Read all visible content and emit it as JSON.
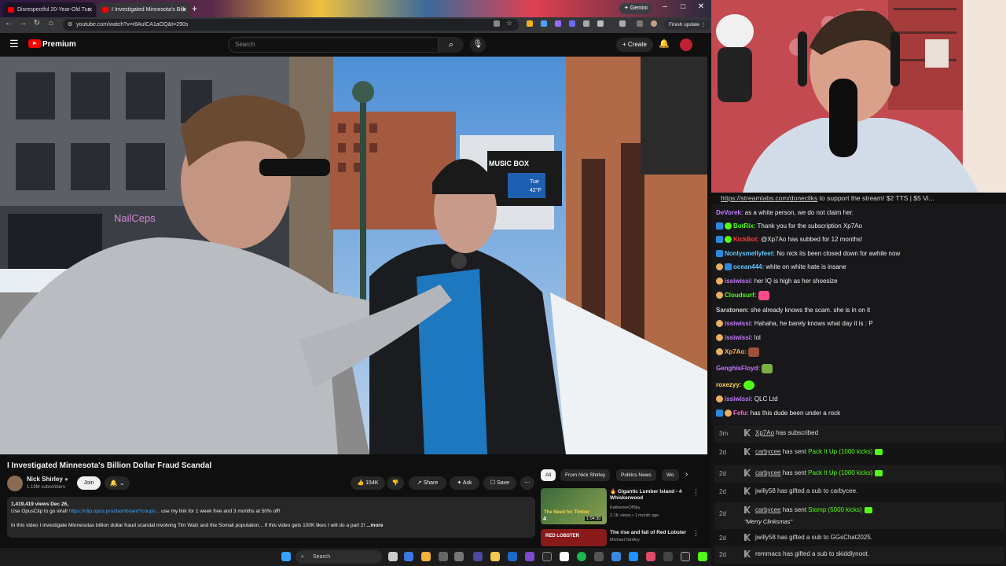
{
  "browser": {
    "tabs": [
      {
        "label": "Disrespectful 20-Year-Old Tur"
      },
      {
        "label": "I Investigated Minnesota's Billi"
      }
    ],
    "gemini": "Gemini",
    "url": "youtube.com/watch?v=r8AulCA1aOQ&t=290s",
    "finish_update": "Finish update"
  },
  "youtube": {
    "brand": "Premium",
    "search_placeholder": "Search",
    "create": "Create",
    "video": {
      "storefront_sign": "NailCeps",
      "kiosk_sign": "MUSIC BOX",
      "kiosk_day": "Tue",
      "kiosk_temp": "42°F"
    },
    "title": "I Investigated Minnesota's Billion Dollar Fraud Scandal",
    "channel": "Nick Shirley",
    "subscribers": "1.18M subscribers",
    "join": "Join",
    "likes": "154K",
    "share": "Share",
    "ask": "Ask",
    "save": "Save",
    "description": {
      "stats": "1,419,419 views  Dec 26,",
      "line2_prefix": "Use OpusClip to go viral!",
      "line2_link": "https://clip.opus.pro/dashboard?coupo...",
      "line2_suffix": "use my link for 1 week free and 3 months at 50% off!",
      "line3": "In this video I investigate Minnesotas billion dollar fraud scandal involving Tim Walz and the Somali population... if this video gets 100K likes I will do a part 2!",
      "more": "...more"
    },
    "chips": [
      "All",
      "From Nick Shirley",
      "Politics News",
      "Wo"
    ],
    "recommendations": [
      {
        "title": "Gigantic Lumber Island - 4 Whiskerwood",
        "channel": "KatherineOfSky",
        "meta": "2.1K views • 1 month ago",
        "duration": "1:04:30",
        "thumb_text": "The Need for Timber",
        "badge": "4"
      },
      {
        "title": "The rise and fall of Red Lobster",
        "channel": "Michael Girdley",
        "meta": "",
        "thumb_text": "RED LOBSTER"
      }
    ]
  },
  "taskbar": {
    "search": "Search"
  },
  "chat": {
    "ticker_link": "https://streamlabs.com/donecliks",
    "ticker_text": " to support the stream! $2 TTS | $5 Vi...",
    "messages": [
      {
        "user": "DeVorek:",
        "text": " as a white person, we do not claim her.",
        "color": "#c679ff"
      },
      {
        "user": "BotRix:",
        "text": " Thank you for the subscription Xp7Ao",
        "color": "#53fc18"
      },
      {
        "user": "KickBot:",
        "text": " @Xp7Ao has subbed for 12 months!",
        "color": "#ff3b3b"
      },
      {
        "user": "Nonlysmellyfeet:",
        "text": " No nick its been closed down for awhile now",
        "color": "#5ec8ff"
      },
      {
        "user": "ocean444:",
        "text": " white on white hate is insane",
        "color": "#5ec8ff"
      },
      {
        "user": "issiwissi:",
        "text": " her IQ is high as her shoesize",
        "color": "#c679ff"
      },
      {
        "user": "Cloudsurf:",
        "text": " ",
        "color": "#53fc18"
      },
      {
        "user": "Saratonen:",
        "text": " she already knows the scam. she is in on it",
        "color": "#ccc"
      },
      {
        "user": "issiwissi:",
        "text": " Hahaha, he barely knows what day it is : P",
        "color": "#c679ff"
      },
      {
        "user": "issiwissi:",
        "text": " lol",
        "color": "#c679ff"
      },
      {
        "user": "Xp7Ao:",
        "text": " ",
        "color": "#ffb347"
      },
      {
        "user": "GenghisFloyd:",
        "text": " ",
        "color": "#c679ff"
      },
      {
        "user": "roxezyy:",
        "text": " ",
        "color": "#ffd84d"
      },
      {
        "user": "issiwissi:",
        "text": " QLC Ltd",
        "color": "#c679ff"
      },
      {
        "user": "Fefu:",
        "text": " has this dude been under a rock",
        "color": "#ff6ad5"
      }
    ]
  },
  "feed": [
    {
      "time": "3m",
      "user": "Xp7Ao",
      "text": " has subscribed",
      "gift": ""
    },
    {
      "time": "2d",
      "user": "carbycee",
      "text": " has sent ",
      "gift": "Pack It Up (1000 kicks)"
    },
    {
      "time": "2d",
      "user": "carbycee",
      "text": " has sent ",
      "gift": "Pack It Up (1000 kicks)"
    },
    {
      "time": "2d",
      "user": "jwilly58",
      "text": " has gifted a sub to carbycee.",
      "gift": ""
    },
    {
      "time": "2d",
      "user": "carbycee",
      "text": " has sent ",
      "gift": "Stomp (5000 kicks)",
      "note": "\"Merry Clinksmas\""
    },
    {
      "time": "2d",
      "user": "jwilly58",
      "text": " has gifted a sub to GGsChat2025.",
      "gift": ""
    },
    {
      "time": "2d",
      "user": "remmacs",
      "text": " has gifted a sub to skiddlynoot.",
      "gift": ""
    }
  ]
}
